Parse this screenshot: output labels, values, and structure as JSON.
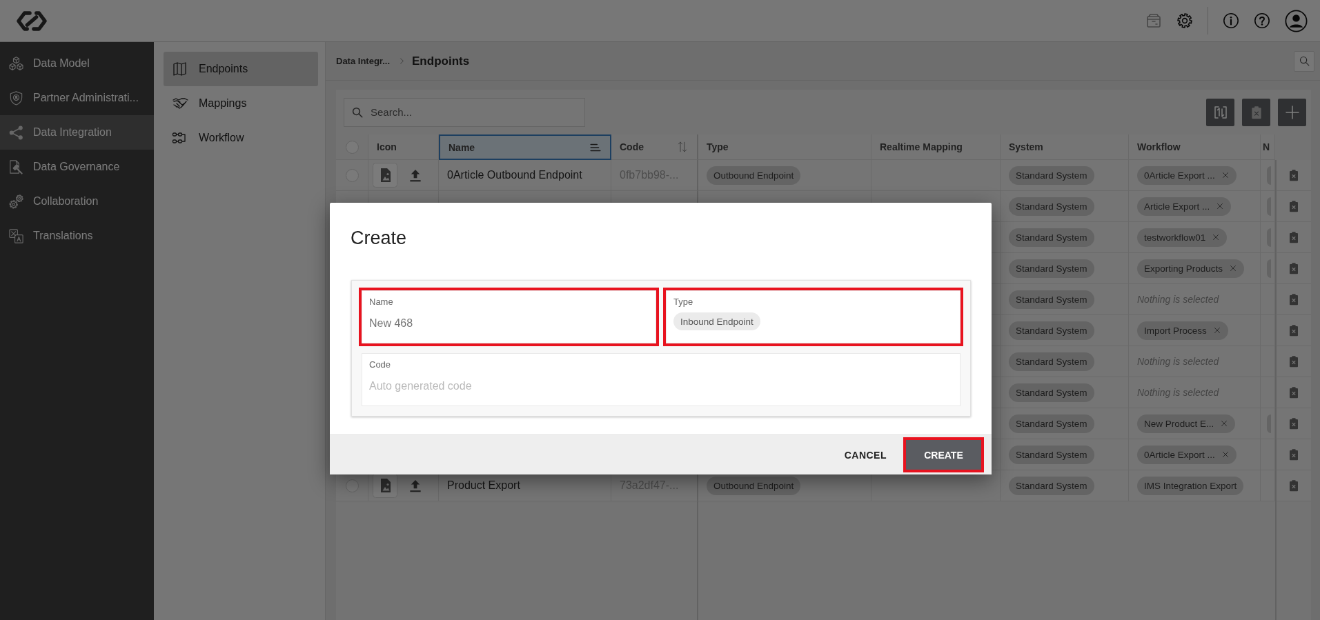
{
  "topbar": {
    "actions": [
      {
        "disabled": true
      },
      {
        "disabled": false
      },
      {
        "disabled": false
      },
      {
        "disabled": false
      },
      {
        "disabled": false
      }
    ]
  },
  "sidebar": {
    "items": [
      {
        "label": "Data Model",
        "selected": false
      },
      {
        "label": "Partner Administrati...",
        "selected": false
      },
      {
        "label": "Data Integration",
        "selected": true
      },
      {
        "label": "Data Governance",
        "selected": false
      },
      {
        "label": "Collaboration",
        "selected": false
      },
      {
        "label": "Translations",
        "selected": false
      }
    ]
  },
  "subnav": {
    "items": [
      {
        "label": "Endpoints",
        "selected": true
      },
      {
        "label": "Mappings",
        "selected": false
      },
      {
        "label": "Workflow",
        "selected": false
      }
    ]
  },
  "breadcrumb": {
    "items": [
      "Data Integr...",
      "Endpoints"
    ]
  },
  "toolbar": {
    "search": {
      "placeholder": "Search..."
    }
  },
  "table": {
    "select_all": {
      "checked": false
    },
    "columns": [
      {
        "label": "Icon",
        "selected": false
      },
      {
        "label": "Name",
        "selected": true,
        "sorted": true
      },
      {
        "label": "Code",
        "selected": false,
        "sorted": false
      },
      {
        "label": "Type",
        "selected": false
      },
      {
        "label": "Realtime Mapping",
        "selected": false
      },
      {
        "label": "System",
        "selected": false
      },
      {
        "label": "Workflow",
        "selected": false
      },
      {
        "label": "N",
        "selected": false
      }
    ],
    "rows": [
      {
        "checked": false,
        "name": "0Article Outbound Endpoint",
        "code": "0fb7bb98-...",
        "type": "Outbound Endpoint",
        "system": "Standard System",
        "workflow": {
          "kind": "tag",
          "label": "0Article Export ...",
          "removable": true
        },
        "column_9_tag": true
      },
      {
        "system": "Standard System",
        "workflow": {
          "kind": "tag",
          "label": "Article Export ...",
          "removable": true
        },
        "column_9_tag": true
      },
      {
        "system": "Standard System",
        "workflow": {
          "kind": "tag",
          "label": "testworkflow01",
          "removable": true
        },
        "column_9_tag": true
      },
      {
        "system": "Standard System",
        "workflow": {
          "kind": "tag",
          "label": "Exporting Products",
          "removable": true
        },
        "column_9_tag": true
      },
      {
        "system": "Standard System",
        "workflow": {
          "kind": "placeholder",
          "label": "Nothing is selected"
        },
        "column_9_tag": false
      },
      {
        "system": "Standard System",
        "workflow": {
          "kind": "tag",
          "label": "Import Process",
          "removable": true
        },
        "column_9_tag": false
      },
      {
        "system": "Standard System",
        "workflow": {
          "kind": "placeholder",
          "label": "Nothing is selected"
        },
        "column_9_tag": false
      },
      {
        "system": "Standard System",
        "workflow": {
          "kind": "placeholder",
          "label": "Nothing is selected"
        },
        "column_9_tag": false
      },
      {
        "system": "Standard System",
        "workflow": {
          "kind": "tag",
          "label": "New Product E...",
          "removable": true
        },
        "column_9_tag": true
      },
      {
        "system": "Standard System",
        "workflow": {
          "kind": "tag",
          "label": "0Article Export ...",
          "removable": true
        },
        "column_9_tag": false
      },
      {
        "checked": false,
        "name": "Product Export",
        "code": "73a2df47-...",
        "type": "Outbound Endpoint",
        "system": "Standard System",
        "workflow": {
          "kind": "tag",
          "label": "IMS Integration Export",
          "removable": false
        },
        "column_9_tag": false
      }
    ]
  },
  "dialog": {
    "title": "Create",
    "fields": [
      {
        "kind": "text",
        "label": "Name",
        "value": "New 468",
        "highlighted": true
      },
      {
        "kind": "tag",
        "label": "Type",
        "value": "Inbound Endpoint",
        "highlighted": true
      },
      {
        "kind": "text",
        "label": "Code",
        "placeholder": "Auto generated code",
        "highlighted": false
      }
    ],
    "buttons": [
      {
        "kind": "flat",
        "label": "CANCEL",
        "highlighted": false
      },
      {
        "kind": "primary",
        "label": "CREATE",
        "highlighted": true
      }
    ]
  }
}
